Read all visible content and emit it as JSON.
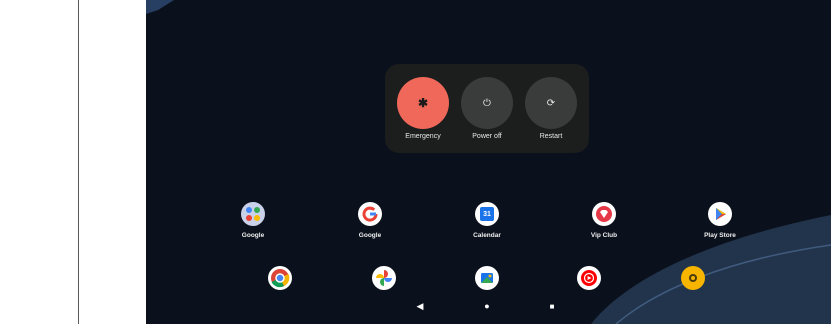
{
  "power_menu": {
    "buttons": [
      {
        "label": "Emergency",
        "icon": "asterisk-icon",
        "glyph": "✱"
      },
      {
        "label": "Power off",
        "icon": "power-icon",
        "glyph": "⏻"
      },
      {
        "label": "Restart",
        "icon": "restart-icon",
        "glyph": "⟳"
      }
    ]
  },
  "apps": [
    {
      "label": "Google",
      "icon": "google-folder-icon"
    },
    {
      "label": "Google",
      "icon": "google-icon"
    },
    {
      "label": "Calendar",
      "icon": "calendar-icon",
      "text": "31"
    },
    {
      "label": "Vip Club",
      "icon": "vip-club-icon"
    },
    {
      "label": "Play Store",
      "icon": "play-store-icon"
    }
  ],
  "dock": [
    {
      "icon": "chrome-icon"
    },
    {
      "icon": "photos-icon"
    },
    {
      "icon": "files-icon"
    },
    {
      "icon": "youtube-music-icon"
    },
    {
      "icon": "camera-icon"
    }
  ],
  "nav": [
    {
      "icon": "back-icon",
      "glyph": "◀"
    },
    {
      "icon": "home-icon",
      "glyph": "●"
    },
    {
      "icon": "recents-icon",
      "glyph": "■"
    }
  ],
  "colors": {
    "emergency": "#f0685a",
    "wallpaper": "#0b111c",
    "menu": "#1b1e1c"
  }
}
